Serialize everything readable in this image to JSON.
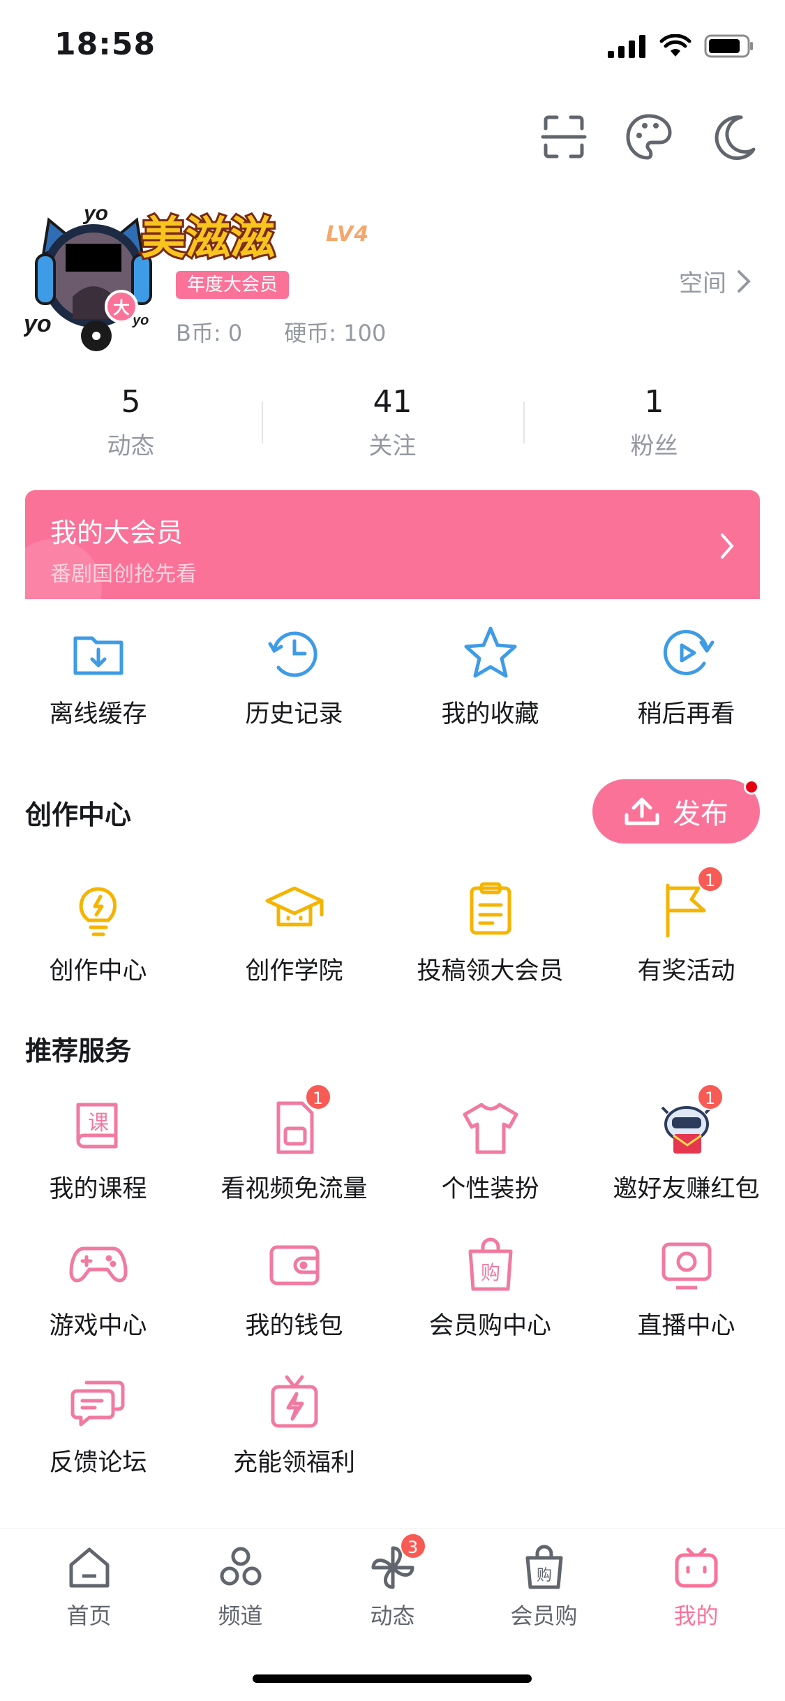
{
  "status_bar": {
    "time": "18:58"
  },
  "profile": {
    "username": "美滋滋",
    "level": "LV4",
    "vip_tag": "年度大会员",
    "b_coin": "B币: 0",
    "coin": "硬币: 100",
    "space_label": "空间"
  },
  "stats": [
    {
      "num": "5",
      "label": "动态"
    },
    {
      "num": "41",
      "label": "关注"
    },
    {
      "num": "1",
      "label": "粉丝"
    }
  ],
  "vip_banner": {
    "title": "我的大会员",
    "subtitle": "番剧国创抢先看"
  },
  "quick_actions": [
    {
      "label": "离线缓存"
    },
    {
      "label": "历史记录"
    },
    {
      "label": "我的收藏"
    },
    {
      "label": "稍后再看"
    }
  ],
  "creation": {
    "title": "创作中心",
    "publish_label": "发布",
    "items": [
      {
        "label": "创作中心"
      },
      {
        "label": "创作学院"
      },
      {
        "label": "投稿领大会员"
      },
      {
        "label": "有奖活动",
        "badge": "1"
      }
    ]
  },
  "services": {
    "title": "推荐服务",
    "items": [
      {
        "label": "我的课程",
        "icon_text": "课"
      },
      {
        "label": "看视频免流量",
        "badge": "1"
      },
      {
        "label": "个性装扮"
      },
      {
        "label": "邀好友赚红包",
        "badge": "1"
      },
      {
        "label": "游戏中心"
      },
      {
        "label": "我的钱包"
      },
      {
        "label": "会员购中心",
        "icon_text": "购"
      },
      {
        "label": "直播中心"
      },
      {
        "label": "反馈论坛"
      },
      {
        "label": "充能领福利"
      }
    ]
  },
  "bottom_nav": [
    {
      "label": "首页"
    },
    {
      "label": "频道"
    },
    {
      "label": "动态",
      "badge": "3"
    },
    {
      "label": "会员购",
      "icon_text": "购"
    },
    {
      "label": "我的"
    }
  ],
  "colors": {
    "accent": "#fb7299",
    "badge": "#f85a54",
    "blue_icon": "#3e9be6",
    "yellow_icon": "#f5b400",
    "text_gray": "#9499a0"
  }
}
